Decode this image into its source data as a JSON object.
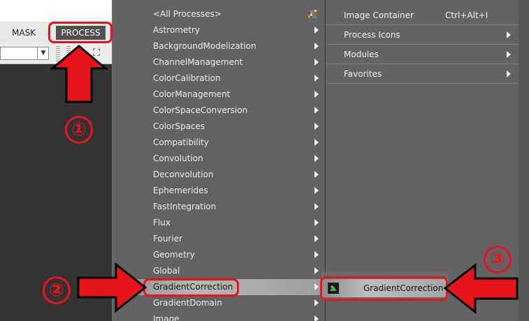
{
  "host": {
    "menu_mask": "MASK",
    "menu_process": "PROCESS"
  },
  "main_menu": {
    "items": [
      {
        "label": "<All Processes>",
        "has_submenu": false,
        "selected": false
      },
      {
        "label": "Astrometry",
        "has_submenu": true,
        "selected": false
      },
      {
        "label": "BackgroundModelization",
        "has_submenu": true,
        "selected": false
      },
      {
        "label": "ChannelManagement",
        "has_submenu": true,
        "selected": false
      },
      {
        "label": "ColorCalibration",
        "has_submenu": true,
        "selected": false
      },
      {
        "label": "ColorManagement",
        "has_submenu": true,
        "selected": false
      },
      {
        "label": "ColorSpaceConversion",
        "has_submenu": true,
        "selected": false
      },
      {
        "label": "ColorSpaces",
        "has_submenu": true,
        "selected": false
      },
      {
        "label": "Compatibility",
        "has_submenu": true,
        "selected": false
      },
      {
        "label": "Convolution",
        "has_submenu": true,
        "selected": false
      },
      {
        "label": "Deconvolution",
        "has_submenu": true,
        "selected": false
      },
      {
        "label": "Ephemerides",
        "has_submenu": true,
        "selected": false
      },
      {
        "label": "FastIntegration",
        "has_submenu": true,
        "selected": false
      },
      {
        "label": "Flux",
        "has_submenu": true,
        "selected": false
      },
      {
        "label": "Fourier",
        "has_submenu": true,
        "selected": false
      },
      {
        "label": "Geometry",
        "has_submenu": true,
        "selected": false
      },
      {
        "label": "Global",
        "has_submenu": true,
        "selected": false
      },
      {
        "label": "GradientCorrection",
        "has_submenu": true,
        "selected": true
      },
      {
        "label": "GradientDomain",
        "has_submenu": true,
        "selected": false
      },
      {
        "label": "Image",
        "has_submenu": true,
        "selected": false
      }
    ]
  },
  "sub_menu": {
    "items": [
      {
        "label": "Image Container",
        "shortcut": "Ctrl+Alt+I",
        "has_submenu": false
      },
      {
        "label": "Process Icons",
        "shortcut": "",
        "has_submenu": true
      },
      {
        "label": "Modules",
        "shortcut": "",
        "has_submenu": true
      },
      {
        "label": "Favorites",
        "shortcut": "",
        "has_submenu": true
      }
    ]
  },
  "gradient_submenu": {
    "item_label": "GradientCorrection"
  },
  "annotations": {
    "step1": "①",
    "step2": "②",
    "step3": "③",
    "color": "#e8141c"
  }
}
